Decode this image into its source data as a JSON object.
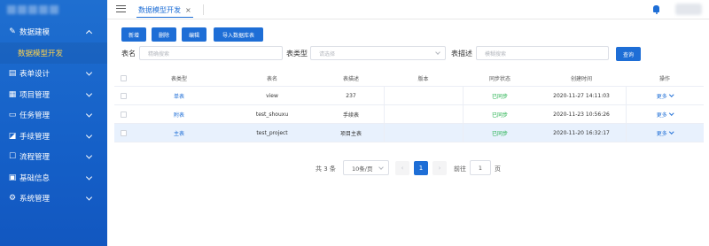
{
  "sidebar": {
    "items": [
      {
        "label": "数据建模",
        "icon": "edit-icon",
        "glyph": "✎",
        "expanded": true
      },
      {
        "label": "表单设计",
        "icon": "form-icon",
        "glyph": "▤",
        "expanded": false
      },
      {
        "label": "项目管理",
        "icon": "project-icon",
        "glyph": "▦",
        "expanded": false
      },
      {
        "label": "任务管理",
        "icon": "task-icon",
        "glyph": "▭",
        "expanded": false
      },
      {
        "label": "手续管理",
        "icon": "procedure-icon",
        "glyph": "◪",
        "expanded": false
      },
      {
        "label": "流程管理",
        "icon": "flow-icon",
        "glyph": "☐",
        "expanded": false
      },
      {
        "label": "基础信息",
        "icon": "info-icon",
        "glyph": "▣",
        "expanded": false
      },
      {
        "label": "系统管理",
        "icon": "settings-icon",
        "glyph": "⚙",
        "expanded": false
      }
    ],
    "submenu_active": "数据模型开发"
  },
  "header": {
    "tab_label": "数据模型开发",
    "tab_close": "×"
  },
  "toolbar": {
    "add": "新增",
    "delete": "删除",
    "edit": "编辑",
    "import": "导入数据库表"
  },
  "search": {
    "name_label": "表名",
    "name_placeholder": "精确搜索",
    "type_label": "表类型",
    "type_placeholder": "请选择",
    "desc_label": "表描述",
    "desc_placeholder": "模糊搜索",
    "query": "查询"
  },
  "table": {
    "headers": [
      "表类型",
      "表名",
      "表描述",
      "版本",
      "同步状态",
      "创建时间",
      "操作"
    ],
    "rows": [
      {
        "type": "单表",
        "name": "view",
        "desc": "237",
        "version": "",
        "status": "已同步",
        "created": "2020-11-27 14:11:03",
        "action": "更多"
      },
      {
        "type": "附表",
        "name": "test_shouxu",
        "desc": "手续表",
        "version": "",
        "status": "已同步",
        "created": "2020-11-23 10:56:26",
        "action": "更多"
      },
      {
        "type": "主表",
        "name": "test_project",
        "desc": "项目主表",
        "version": "",
        "status": "已同步",
        "created": "2020-11-20 16:32:17",
        "action": "更多"
      }
    ]
  },
  "pagination": {
    "total": "共 3 条",
    "page_size": "10条/页",
    "prev": "‹",
    "current": "1",
    "next": "›",
    "goto_label": "前往",
    "goto_value": "1",
    "page_unit": "页"
  },
  "colors": {
    "primary": "#1e6ed6",
    "sidebar": "#1560c8",
    "active_submenu": "#ffd34d",
    "success": "#23b14d"
  }
}
